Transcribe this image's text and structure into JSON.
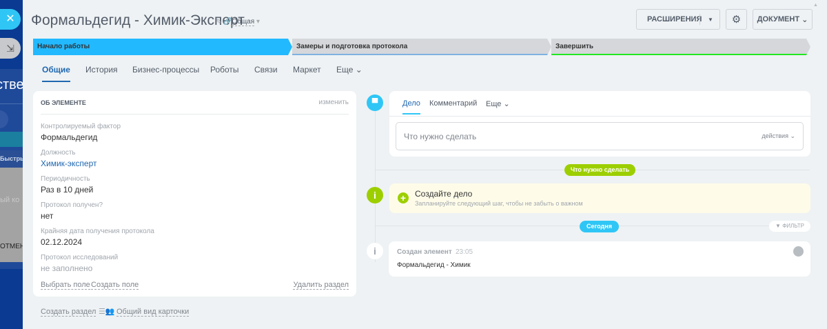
{
  "sidebar": {
    "fragments": [
      "ствен",
      "Быстры",
      "ный ко",
      "ОТМЕНИТ"
    ]
  },
  "header": {
    "title": "Формальдегид - Химик-Эксперт",
    "access": "Общая",
    "extensions": "РАСШИРЕНИЯ",
    "document": "ДОКУМЕНТ"
  },
  "stages": [
    {
      "label": "Начало работы",
      "color": "#22b9ff"
    },
    {
      "label": "Замеры и подготовка протокола",
      "color": "#d5d7db"
    },
    {
      "label": "Завершить",
      "color": "#d5d7db"
    }
  ],
  "tabs": [
    "Общие",
    "История",
    "Бизнес-процессы",
    "Роботы",
    "Связи",
    "Маркет",
    "Еще"
  ],
  "about": {
    "title": "ОБ ЭЛЕМЕНТЕ",
    "edit": "изменить",
    "fields": [
      {
        "label": "Контролируемый фактор",
        "value": "Формальдегид"
      },
      {
        "label": "Должность",
        "value": "Химик-эксперт"
      },
      {
        "label": "Периодичность",
        "value": "Раз в 10 дней"
      },
      {
        "label": "Протокол получен?",
        "value": "нет"
      },
      {
        "label": "Крайняя дата получения протокола",
        "value": "02.12.2024"
      },
      {
        "label": "Протокол исследований",
        "value": "не заполнено"
      }
    ],
    "select_field": "Выбрать поле",
    "create_field": "Создать поле",
    "delete_section": "Удалить раздел"
  },
  "footer": {
    "create_section": "Создать раздел",
    "card_view": "Общий вид карточки"
  },
  "timeline": {
    "tabs": [
      "Дело",
      "Комментарий",
      "Еще"
    ],
    "placeholder": "Что нужно сделать",
    "actions": "действия",
    "todo_pill": "Что нужно сделать",
    "create_title": "Создайте дело",
    "create_sub": "Запланируйте следующий шаг, чтобы не забыть о важном",
    "today_pill": "Сегодня",
    "filter": "ФИЛЬТР",
    "event_title": "Создан элемент",
    "event_time": "23:05",
    "event_text": "Формальдегид - Химик"
  }
}
